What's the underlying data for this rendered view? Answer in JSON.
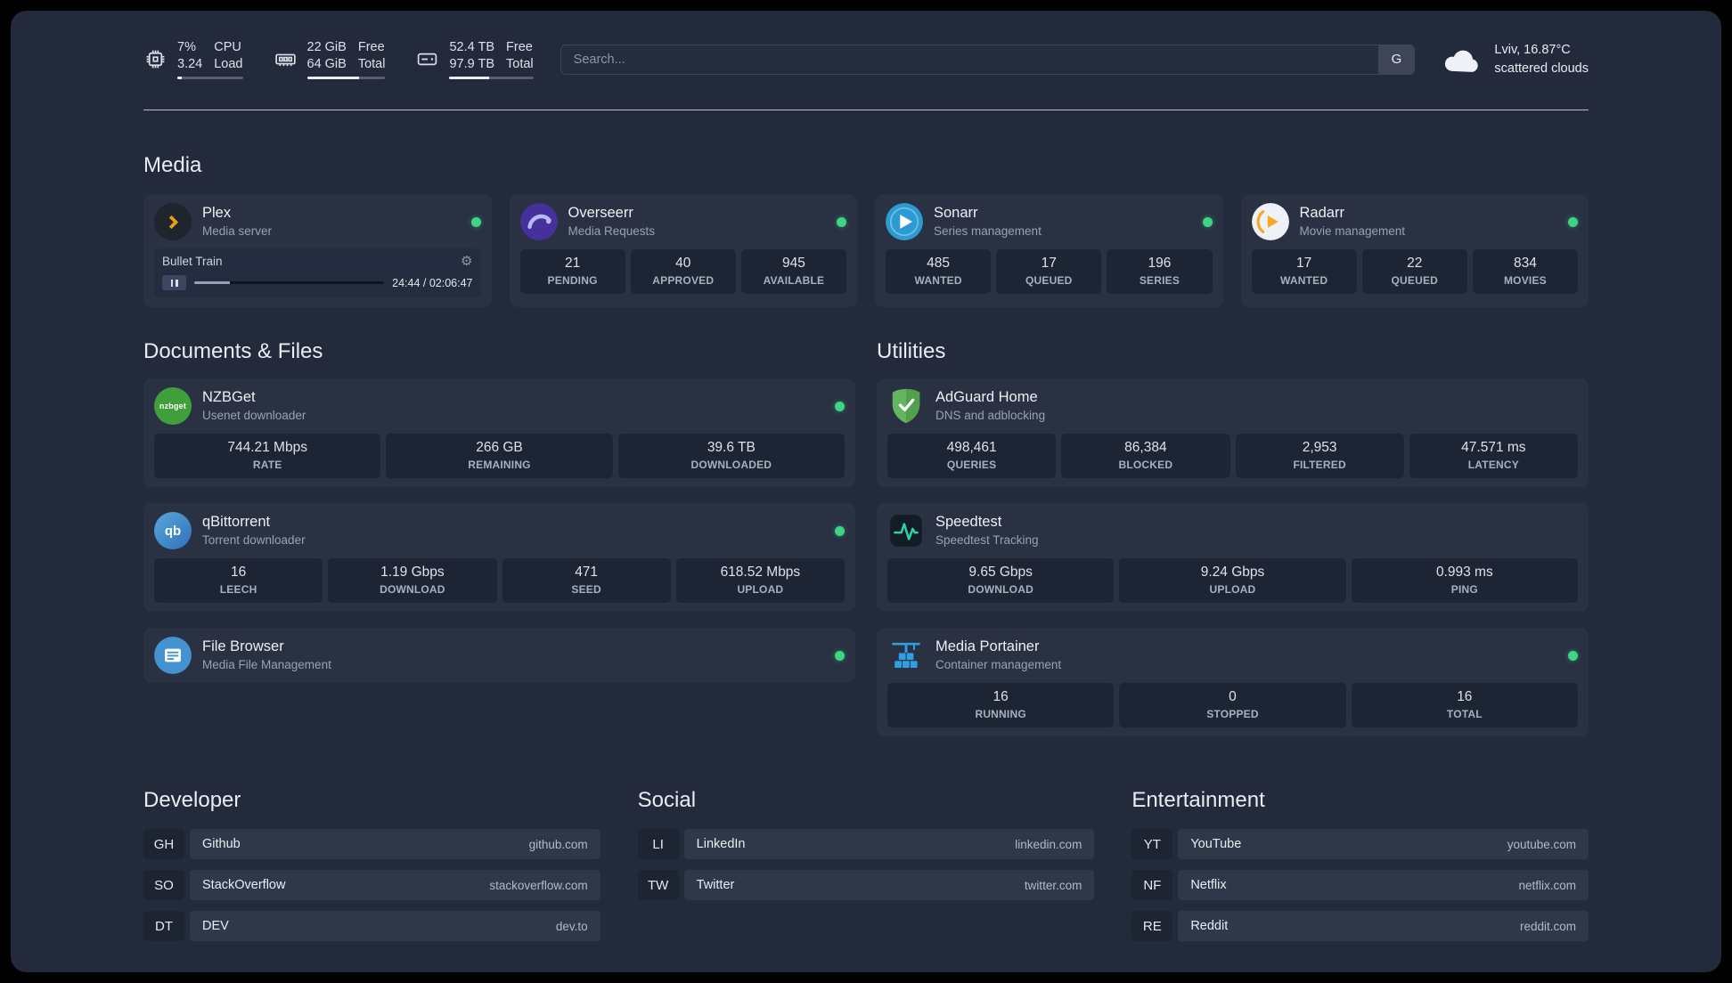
{
  "icons": {
    "gear": "⚙"
  },
  "topbar": {
    "resources": [
      {
        "name": "cpu",
        "value1": "7%",
        "value2": "3.24",
        "label1": "CPU",
        "label2": "Load",
        "bar_pct": 7
      },
      {
        "name": "memory",
        "value1": "22 GiB",
        "value2": "64 GiB",
        "label1": "Free",
        "label2": "Total",
        "bar_pct": 66
      },
      {
        "name": "disk",
        "value1": "52.4 TB",
        "value2": "97.9 TB",
        "label1": "Free",
        "label2": "Total",
        "bar_pct": 47
      }
    ],
    "search": {
      "placeholder": "Search...",
      "provider_button": "G"
    },
    "weather": {
      "location": "Lviv, 16.87°C",
      "condition": "scattered clouds"
    }
  },
  "sections": {
    "media": {
      "title": "Media",
      "plex": {
        "name": "Plex",
        "subtitle": "Media server",
        "status": "online",
        "player": {
          "title": "Bullet Train",
          "time": "24:44 / 02:06:47",
          "progress_pct": 19
        }
      },
      "overseerr": {
        "name": "Overseerr",
        "subtitle": "Media Requests",
        "status": "online",
        "stats": [
          {
            "value": "21",
            "label": "PENDING"
          },
          {
            "value": "40",
            "label": "APPROVED"
          },
          {
            "value": "945",
            "label": "AVAILABLE"
          }
        ]
      },
      "sonarr": {
        "name": "Sonarr",
        "subtitle": "Series management",
        "status": "online",
        "stats": [
          {
            "value": "485",
            "label": "WANTED"
          },
          {
            "value": "17",
            "label": "QUEUED"
          },
          {
            "value": "196",
            "label": "SERIES"
          }
        ]
      },
      "radarr": {
        "name": "Radarr",
        "subtitle": "Movie management",
        "status": "online",
        "stats": [
          {
            "value": "17",
            "label": "WANTED"
          },
          {
            "value": "22",
            "label": "QUEUED"
          },
          {
            "value": "834",
            "label": "MOVIES"
          }
        ]
      }
    },
    "documents": {
      "title": "Documents & Files",
      "nzbget": {
        "name": "NZBGet",
        "subtitle": "Usenet downloader",
        "status": "online",
        "logo_text": "nzbget",
        "stats": [
          {
            "value": "744.21 Mbps",
            "label": "RATE"
          },
          {
            "value": "266 GB",
            "label": "REMAINING"
          },
          {
            "value": "39.6 TB",
            "label": "DOWNLOADED"
          }
        ]
      },
      "qbittorrent": {
        "name": "qBittorrent",
        "subtitle": "Torrent downloader",
        "status": "online",
        "logo_text": "qb",
        "stats": [
          {
            "value": "16",
            "label": "LEECH"
          },
          {
            "value": "1.19 Gbps",
            "label": "DOWNLOAD"
          },
          {
            "value": "471",
            "label": "SEED"
          },
          {
            "value": "618.52 Mbps",
            "label": "UPLOAD"
          }
        ]
      },
      "filebrowser": {
        "name": "File Browser",
        "subtitle": "Media File Management",
        "status": "online"
      }
    },
    "utilities": {
      "title": "Utilities",
      "adguard": {
        "name": "AdGuard Home",
        "subtitle": "DNS and adblocking",
        "stats": [
          {
            "value": "498,461",
            "label": "QUERIES"
          },
          {
            "value": "86,384",
            "label": "BLOCKED"
          },
          {
            "value": "2,953",
            "label": "FILTERED"
          },
          {
            "value": "47.571 ms",
            "label": "LATENCY"
          }
        ]
      },
      "speedtest": {
        "name": "Speedtest",
        "subtitle": "Speedtest Tracking",
        "stats": [
          {
            "value": "9.65 Gbps",
            "label": "DOWNLOAD"
          },
          {
            "value": "9.24 Gbps",
            "label": "UPLOAD"
          },
          {
            "value": "0.993 ms",
            "label": "PING"
          }
        ]
      },
      "portainer": {
        "name": "Media Portainer",
        "subtitle": "Container management",
        "status": "online",
        "stats": [
          {
            "value": "16",
            "label": "RUNNING"
          },
          {
            "value": "0",
            "label": "STOPPED"
          },
          {
            "value": "16",
            "label": "TOTAL"
          }
        ]
      }
    }
  },
  "bookmarks": [
    {
      "title": "Developer",
      "items": [
        {
          "abbr": "GH",
          "name": "Github",
          "url": "github.com"
        },
        {
          "abbr": "SO",
          "name": "StackOverflow",
          "url": "stackoverflow.com"
        },
        {
          "abbr": "DT",
          "name": "DEV",
          "url": "dev.to"
        }
      ]
    },
    {
      "title": "Social",
      "items": [
        {
          "abbr": "LI",
          "name": "LinkedIn",
          "url": "linkedin.com"
        },
        {
          "abbr": "TW",
          "name": "Twitter",
          "url": "twitter.com"
        }
      ]
    },
    {
      "title": "Entertainment",
      "items": [
        {
          "abbr": "YT",
          "name": "YouTube",
          "url": "youtube.com"
        },
        {
          "abbr": "NF",
          "name": "Netflix",
          "url": "netflix.com"
        },
        {
          "abbr": "RE",
          "name": "Reddit",
          "url": "reddit.com"
        }
      ]
    }
  ],
  "colors": {
    "status_online": "#3dd584",
    "accent_amber": "#e5a00d",
    "page_bg": "#222a3b"
  }
}
